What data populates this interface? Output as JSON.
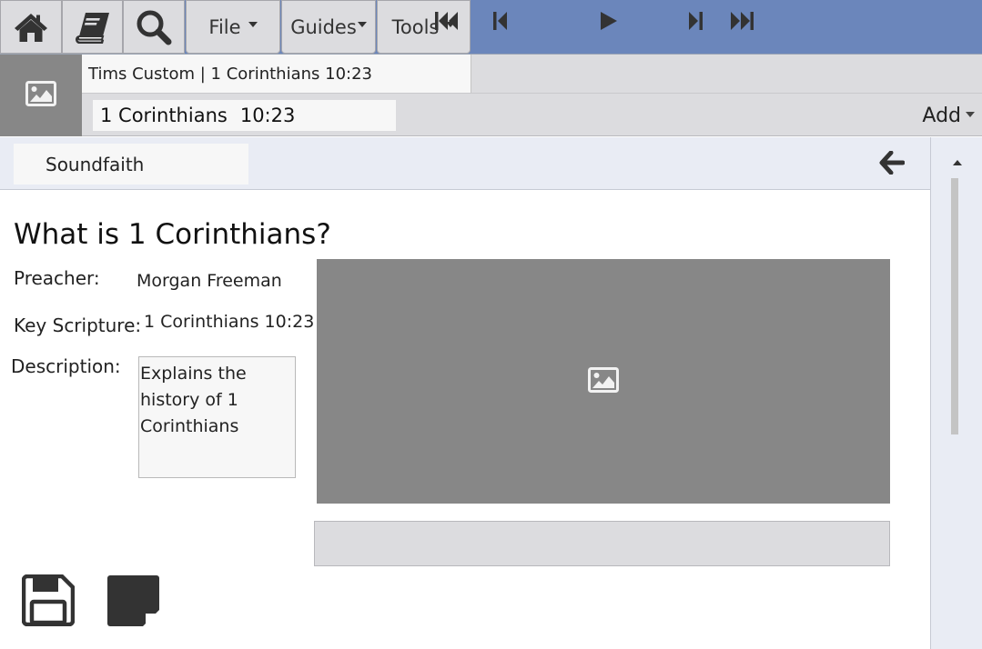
{
  "toolbar": {
    "home_icon": "home-icon",
    "bible_icon": "book-icon",
    "search_icon": "search-icon",
    "menus": {
      "file": "File",
      "guides": "Guides",
      "tools": "Tools"
    },
    "bar_color": "#6b86bb"
  },
  "passage": {
    "tab_label": "Tims Custom | 1 Corinthians 10:23",
    "reference_book": "1 Corinthians",
    "reference_verse": "10:23",
    "add_label": "Add"
  },
  "source": {
    "name": "Soundfaith",
    "back_icon": "arrow-left-icon"
  },
  "sermon": {
    "title": "What is 1 Corinthians?",
    "preacher_label": "Preacher:",
    "preacher": "Morgan Freeman",
    "scripture_label": "Key Scripture:",
    "scripture": "1 Corinthians 10:23",
    "description_label": "Description:",
    "description": "Explains the history of 1 Corinthians"
  },
  "player": {
    "video_placeholder_icon": "image-icon",
    "controls": [
      "skip-to-start-icon",
      "step-back-icon",
      "play-icon",
      "step-forward-icon",
      "skip-to-end-icon"
    ]
  },
  "actions": {
    "save_icon": "save-icon",
    "note_icon": "note-icon"
  }
}
